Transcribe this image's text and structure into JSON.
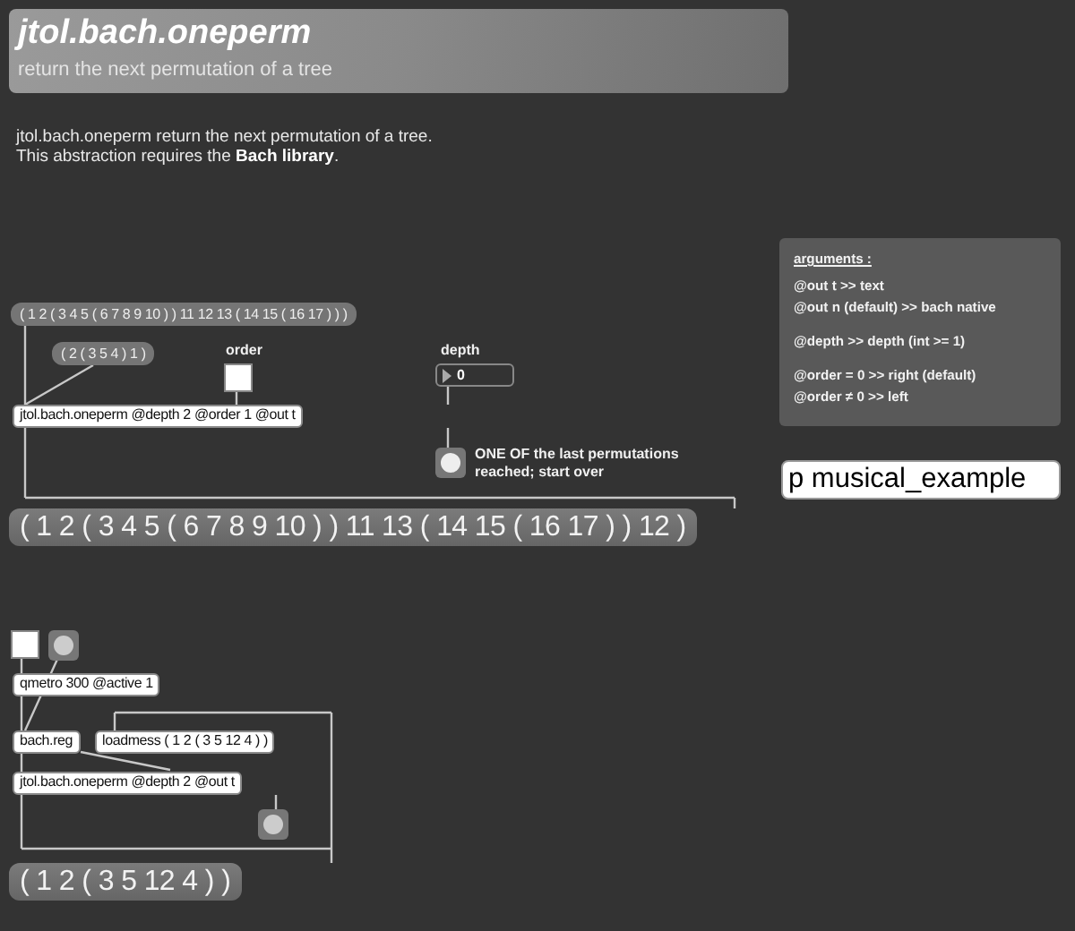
{
  "header": {
    "title": "jtol.bach.oneperm",
    "subtitle": "return the next permutation of a tree"
  },
  "description": [
    "jtol.bach.oneperm return the next permutation of a tree.",
    "This abstraction requires the **Bach library**."
  ],
  "arguments": {
    "heading": "arguments :",
    "groups": [
      [
        "@out t >> text",
        "@out n  (default) >> bach native"
      ],
      [
        "@depth >> depth (int >= 1)"
      ],
      [
        "@order = 0 >> right (default)",
        "@order ≠ 0 >> left"
      ]
    ]
  },
  "subpatch": "p musical_example",
  "objects": [
    {
      "kind": "message",
      "text": "( 1 2 ( 3 4 5 ( 6 7 8 9 10 ) ) 11 12 13 ( 14 15 ( 16 17 ) ) )"
    },
    {
      "kind": "message",
      "text": "( 2 ( 3 5 4 ) 1 )"
    },
    {
      "kind": "comment",
      "text": "order"
    },
    {
      "kind": "toggle",
      "checked": false
    },
    {
      "kind": "comment",
      "text": "depth"
    },
    {
      "kind": "number",
      "text": "0"
    },
    {
      "kind": "object",
      "text": "jtol.bach.oneperm @depth 2 @order 1 @out t"
    },
    {
      "kind": "button"
    },
    {
      "kind": "comment",
      "text": "ONE OF the last permutations reached; start over"
    },
    {
      "kind": "display",
      "text": "( 1 2 ( 3 4 5 ( 6 7 8 9 10 ) ) 11 13 ( 14 15 ( 16 17 ) ) 12 )"
    },
    {
      "kind": "toggle",
      "checked": false
    },
    {
      "kind": "button"
    },
    {
      "kind": "object",
      "text": "qmetro 300 @active 1"
    },
    {
      "kind": "object",
      "text": "bach.reg"
    },
    {
      "kind": "object",
      "text": "loadmess ( 1 2 ( 3 5 12 4 ) )"
    },
    {
      "kind": "object",
      "text": "jtol.bach.oneperm @depth 2 @out t"
    },
    {
      "kind": "button"
    },
    {
      "kind": "display",
      "text": "( 1 2 ( 3 5 12 4 ) )"
    }
  ]
}
